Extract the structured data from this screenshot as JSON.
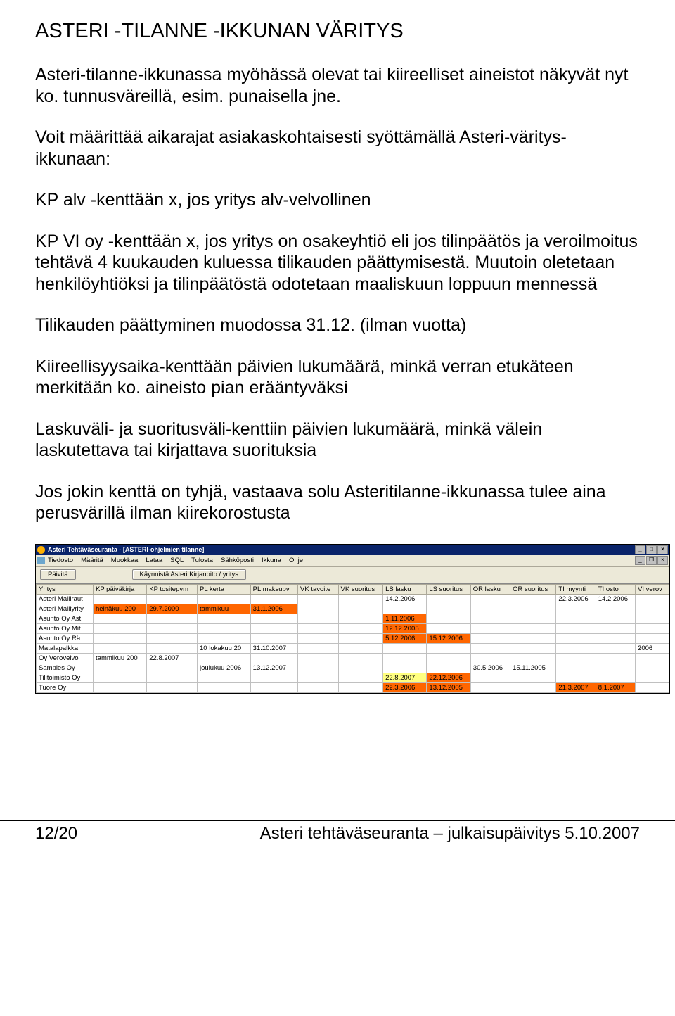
{
  "doc": {
    "title": "ASTERI -TILANNE -IKKUNAN VÄRITYS",
    "paragraphs": [
      "Asteri-tilanne-ikkunassa myöhässä olevat tai kiireelliset aineistot näkyvät nyt ko. tunnusväreillä, esim. punaisella jne.",
      "Voit määrittää aikarajat asiakaskohtaisesti syöttämällä Asteri-väritys-ikkunaan:",
      "KP alv -kenttään x, jos yritys alv-velvollinen",
      "KP VI oy -kenttään x, jos yritys on osakeyhtiö eli jos tilinpäätös ja veroilmoitus tehtävä 4 kuukauden kuluessa tilikauden päättymisestä. Muutoin oletetaan henkilöyhtiöksi ja tilinpäätöstä odotetaan maaliskuun loppuun mennessä",
      "Tilikauden päättyminen muodossa 31.12. (ilman vuotta)",
      "Kiireellisyysaika-kenttään päivien lukumäärä, minkä verran etukäteen merkitään ko. aineisto pian erääntyväksi",
      "Laskuväli- ja suoritusväli-kenttiin päivien lukumäärä, minkä välein laskutettava tai kirjattava suorituksia",
      "Jos jokin kenttä on tyhjä, vastaava solu Asteritilanne-ikkunassa tulee aina perusvärillä ilman kiirekorostusta"
    ]
  },
  "app": {
    "title": "Asteri Tehtäväseuranta - [ASTERI-ohjelmien tilanne]",
    "menu": [
      "Tiedosto",
      "Määritä",
      "Muokkaa",
      "Lataa",
      "SQL",
      "Tulosta",
      "Sähköposti",
      "Ikkuna",
      "Ohje"
    ],
    "toolbar": {
      "refresh": "Päivitä",
      "launch": "Käynnistä Asteri Kirjanpito / yritys"
    },
    "columns": [
      "Yritys",
      "KP päiväkirja",
      "KP tositepvm",
      "PL kerta",
      "PL maksupv",
      "VK tavoite",
      "VK suoritus",
      "LS lasku",
      "LS suoritus",
      "OR lasku",
      "OR suoritus",
      "TI myynti",
      "TI osto",
      "VI verov"
    ],
    "rows": [
      {
        "c": [
          "Asteri Malliraut",
          "",
          "",
          "",
          "",
          "",
          "",
          "14.2.2006",
          "",
          "",
          "",
          "22.3.2006",
          "14.2.2006",
          ""
        ],
        "hl": {}
      },
      {
        "c": [
          "Asteri Malliyrity",
          "heinäkuu 200",
          "29.7.2000",
          "tammikuu",
          "31.1.2006",
          "",
          "",
          "",
          "",
          "",
          "",
          "",
          "",
          ""
        ],
        "hl": {
          "1": "orange",
          "2": "orange",
          "3": "orange",
          "4": "orange"
        }
      },
      {
        "c": [
          "Asunto Oy Ast",
          "",
          "",
          "",
          "",
          "",
          "",
          "1.11.2006",
          "",
          "",
          "",
          "",
          "",
          ""
        ],
        "hl": {
          "7": "orange"
        }
      },
      {
        "c": [
          "Asunto Oy Mit",
          "",
          "",
          "",
          "",
          "",
          "",
          "12.12.2005",
          "",
          "",
          "",
          "",
          "",
          ""
        ],
        "hl": {
          "7": "orange"
        }
      },
      {
        "c": [
          "Asunto Oy Rä",
          "",
          "",
          "",
          "",
          "",
          "",
          "5.12.2006",
          "15.12.2006",
          "",
          "",
          "",
          "",
          ""
        ],
        "hl": {
          "7": "orange",
          "8": "orange"
        }
      },
      {
        "c": [
          "Matalapalkka",
          "",
          "",
          "10 lokakuu 20",
          "31.10.2007",
          "",
          "",
          "",
          "",
          "",
          "",
          "",
          "",
          "2006"
        ],
        "hl": {}
      },
      {
        "c": [
          "Oy Verovelvol",
          "tammikuu 200",
          "22.8.2007",
          "",
          "",
          "",
          "",
          "",
          "",
          "",
          "",
          "",
          "",
          ""
        ],
        "hl": {}
      },
      {
        "c": [
          "Samples Oy",
          "",
          "",
          "joulukuu 2006",
          "13.12.2007",
          "",
          "",
          "",
          "",
          "30.5.2006",
          "15.11.2005",
          "",
          "",
          ""
        ],
        "hl": {}
      },
      {
        "c": [
          "Tilitoimisto Oy",
          "",
          "",
          "",
          "",
          "",
          "",
          "22.8.2007",
          "22.12.2006",
          "",
          "",
          "",
          "",
          ""
        ],
        "hl": {
          "7": "yellow",
          "8": "orange"
        }
      },
      {
        "c": [
          "Tuore Oy",
          "",
          "",
          "",
          "",
          "",
          "",
          "22.3.2006",
          "13.12.2005",
          "",
          "",
          "21.3.2007",
          "8.1.2007",
          ""
        ],
        "hl": {
          "7": "orange",
          "8": "orange",
          "11": "orange",
          "12": "orange"
        }
      }
    ]
  },
  "footer": {
    "left": "12/20",
    "right": "Asteri tehtäväseuranta – julkaisupäivitys 5.10.2007"
  }
}
